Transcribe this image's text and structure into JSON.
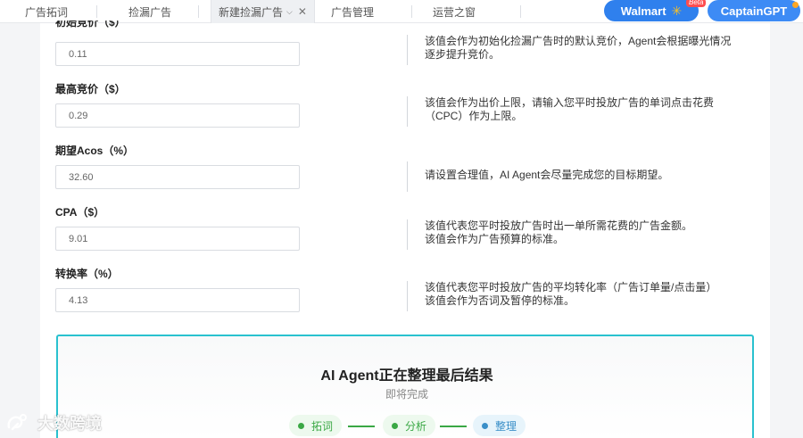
{
  "tabs": [
    {
      "label": "广告拓词"
    },
    {
      "label": "捡漏广告"
    },
    {
      "label": "新建捡漏广告"
    },
    {
      "label": "广告管理"
    },
    {
      "label": "运营之窗"
    }
  ],
  "header": {
    "walmart_label": "Walmart",
    "beta_badge": "Beta",
    "captain_label": "CaptainGPT"
  },
  "fields": [
    {
      "label": "初始竞价（$）",
      "value": "0.11",
      "help": [
        "该值会作为初始化捡漏广告时的默认竞价，Agent会根据曝光情况",
        "逐步提升竞价。"
      ]
    },
    {
      "label": "最高竞价（$）",
      "value": "0.29",
      "help": [
        "该值会作为出价上限，请输入您平时投放广告的单词点击花费",
        "（CPC）作为上限。"
      ]
    },
    {
      "label": "期望Acos（%）",
      "value": "32.60",
      "help": [
        "请设置合理值，AI Agent会尽量完成您的目标期望。"
      ]
    },
    {
      "label": "CPA（$）",
      "value": "9.01",
      "help": [
        "该值代表您平时投放广告时出一单所需花费的广告金额。",
        "该值会作为广告预算的标准。"
      ]
    },
    {
      "label": "转换率（%）",
      "value": "4.13",
      "help": [
        "该值代表您平时投放广告的平均转化率（广告订单量/点击量）",
        "该值会作为否词及暂停的标准。"
      ]
    }
  ],
  "progress": {
    "title": "AI Agent正在整理最后结果",
    "subtitle": "即将完成",
    "steps": [
      {
        "label": "拓词",
        "state": "done"
      },
      {
        "label": "分析",
        "state": "done"
      },
      {
        "label": "整理",
        "state": "current"
      }
    ]
  },
  "watermark": {
    "text": "大数跨境"
  },
  "colors": {
    "accent": "#29c1cf",
    "walmart": "#2f80ed",
    "captain": "#3d8bf5",
    "done": "#3aa845",
    "current": "#3a8fc8"
  }
}
